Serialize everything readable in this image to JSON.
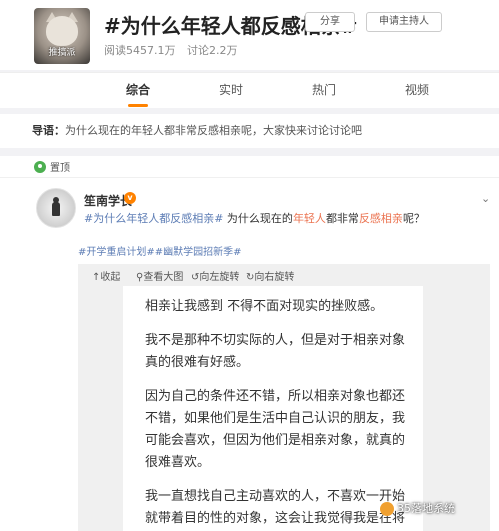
{
  "topic": {
    "title": "#为什么年轻人都反感相亲#",
    "cover_caption": "推搞派",
    "reads": "阅读5457.1万",
    "discussions": "讨论2.2万",
    "share_label": "分享",
    "host_label": "申请主持人"
  },
  "tabs": [
    {
      "label": "综合",
      "active": true
    },
    {
      "label": "实时",
      "active": false
    },
    {
      "label": "热门",
      "active": false
    },
    {
      "label": "视频",
      "active": false
    }
  ],
  "guide": {
    "label": "导语：",
    "text": "为什么现在的年轻人都非常反感相亲呢，大家快来讨论讨论吧"
  },
  "pinned": {
    "label": "置顶"
  },
  "post": {
    "username": "笙南学长",
    "verified_icon": "v",
    "more_icon": "chevron-down-icon",
    "text_topic": "#为什么年轻人都反感相亲#",
    "text_mid": " 为什么现在的",
    "text_hl1": "年轻人",
    "text_mid2": "都非常",
    "text_hl2": "反感相亲",
    "text_end": "呢？",
    "tags": "#开学重启计划##幽默学园招新季#",
    "toolbar": [
      {
        "icon": "collapse-icon",
        "label": "↑收起"
      },
      {
        "icon": "zoom-icon",
        "label": "查看大图"
      },
      {
        "icon": "rotate-left-icon",
        "label": "向左旋转"
      },
      {
        "icon": "rotate-right-icon",
        "label": "向右旋转"
      }
    ],
    "image_paragraphs": [
      "相亲让我感到 不得不面对现实的挫败感。",
      "我不是那种不切实际的人，但是对于相亲对象真的很难有好感。",
      "因为自己的条件还不错，所以相亲对象也都还不错，如果他们是生活中自己认识的朋友，我可能会喜欢，但因为他们是相亲对象，就真的很难喜欢。",
      "我一直想找自己主动喜欢的人，不喜欢一开始就带着目的性的对象，这会让我觉得我是在将就，但是我一个人也可以生活的很好啊。"
    ],
    "watermark": "35落地系统"
  },
  "colors": {
    "accent": "#ff8200",
    "highlight": "#eb7350",
    "link": "#5d7db5"
  }
}
